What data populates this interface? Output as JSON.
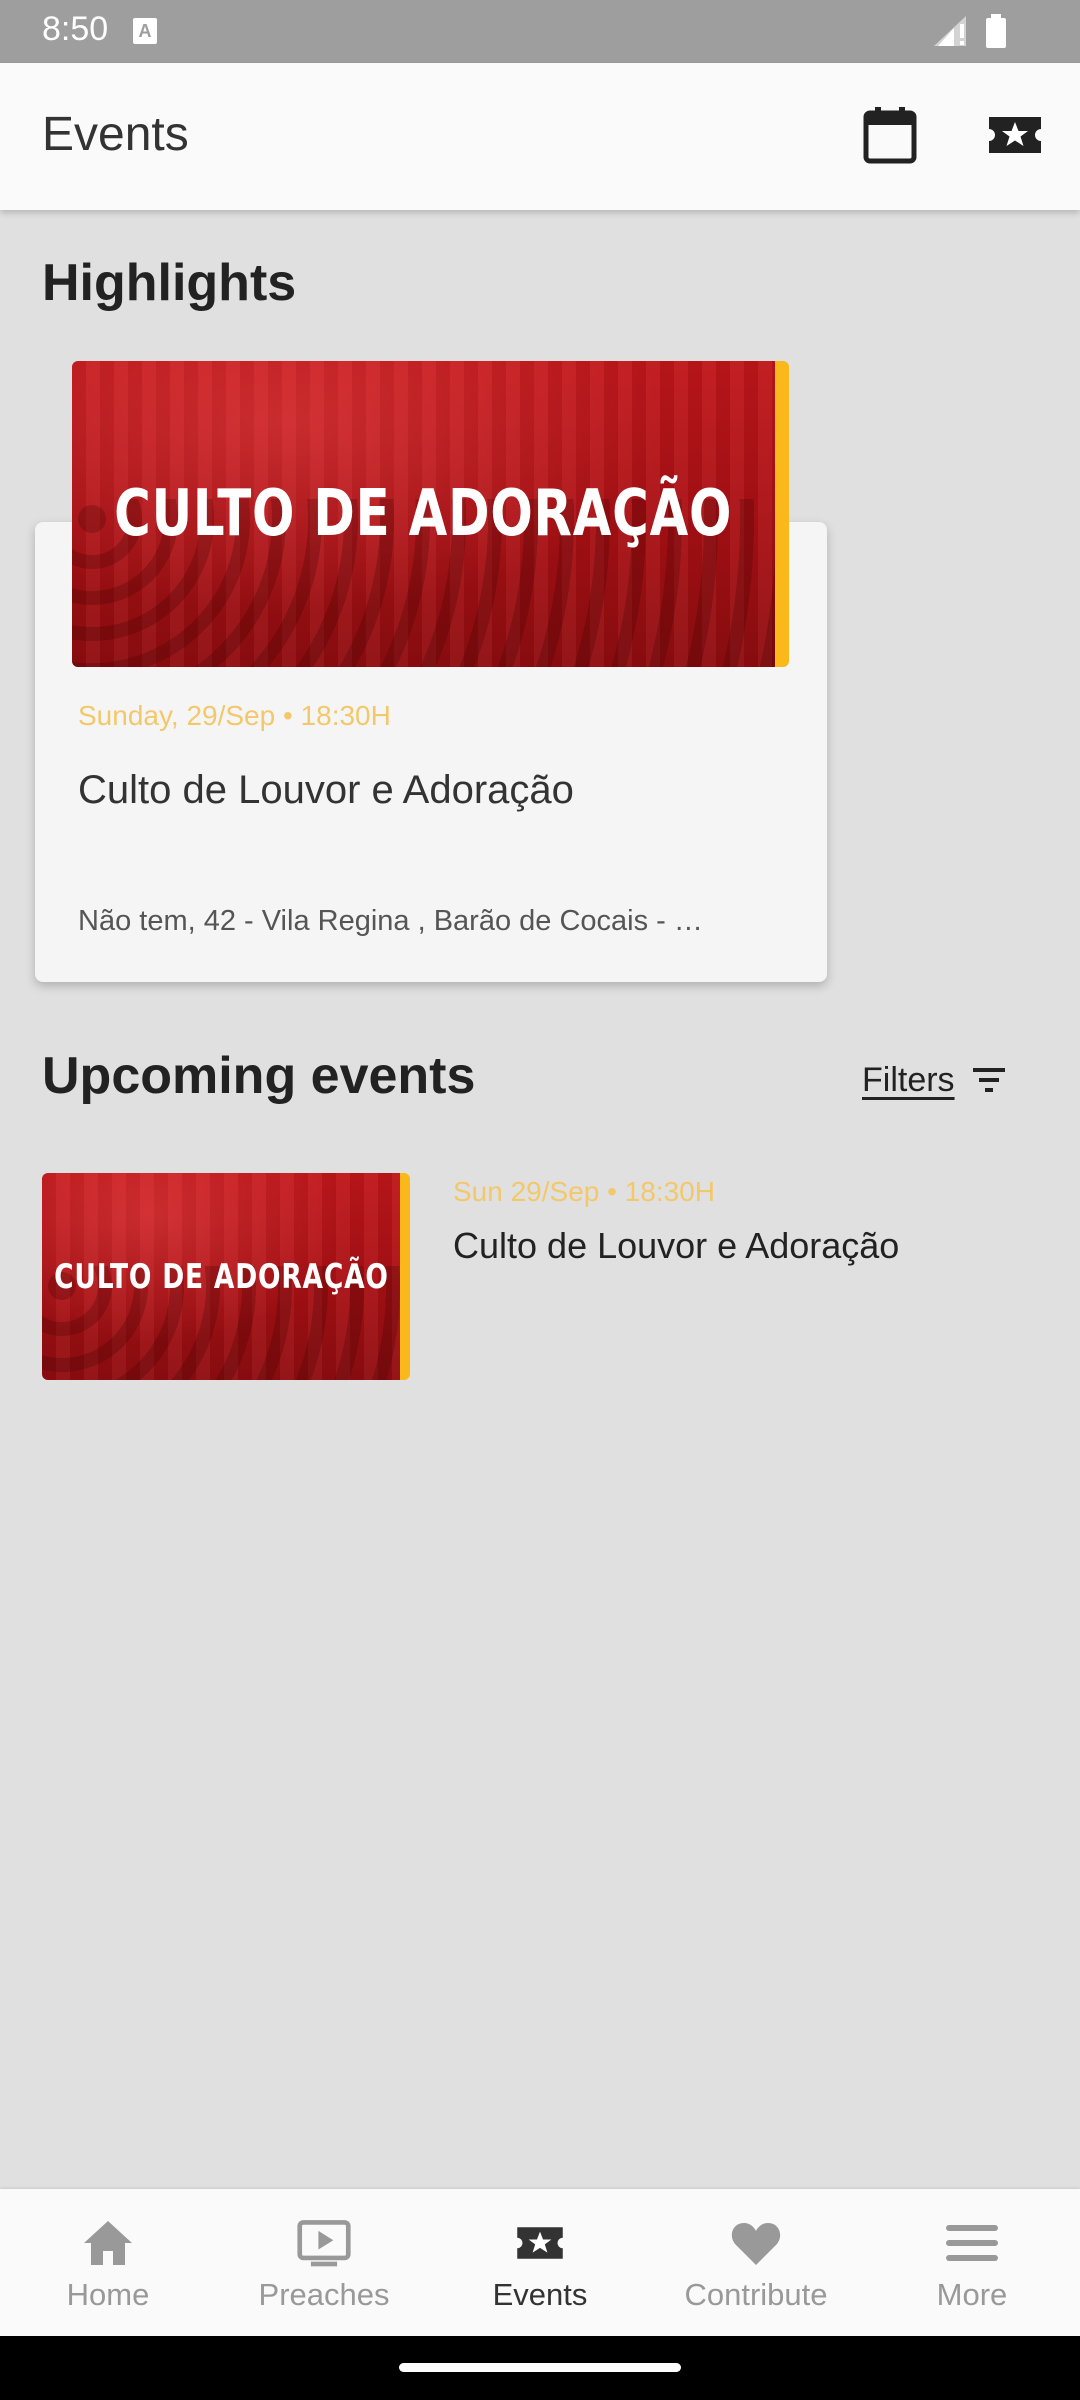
{
  "status_bar": {
    "time": "8:50",
    "notification_icon": "a-icon"
  },
  "app_bar": {
    "title": "Events",
    "actions": [
      {
        "name": "calendar-icon"
      },
      {
        "name": "ticket-star-icon"
      }
    ]
  },
  "highlights": {
    "title": "Highlights",
    "card": {
      "banner_text": "CULTO DE ADORAÇÃO",
      "date": "Sunday, 29/Sep • 18:30H",
      "name": "Culto de Louvor e Adoração",
      "address": "Não tem, 42 - Vila Regina , Barão de Cocais - …"
    }
  },
  "upcoming": {
    "title": "Upcoming events",
    "filters_label": "Filters",
    "items": [
      {
        "banner_text": "CULTO DE ADORAÇÃO",
        "date": "Sun 29/Sep • 18:30H",
        "name": "Culto de Louvor e Adoração"
      }
    ]
  },
  "bottom_nav": {
    "items": [
      {
        "label": "Home",
        "icon": "home-icon"
      },
      {
        "label": "Preaches",
        "icon": "video-play-icon"
      },
      {
        "label": "Events",
        "icon": "ticket-star-icon",
        "active": true
      },
      {
        "label": "Contribute",
        "icon": "heart-icon"
      },
      {
        "label": "More",
        "icon": "menu-icon"
      }
    ]
  },
  "colors": {
    "accent": "#fbb81a",
    "date_text": "#f3c86a",
    "banner_red": "#b31217",
    "background": "#e0e0e0"
  }
}
